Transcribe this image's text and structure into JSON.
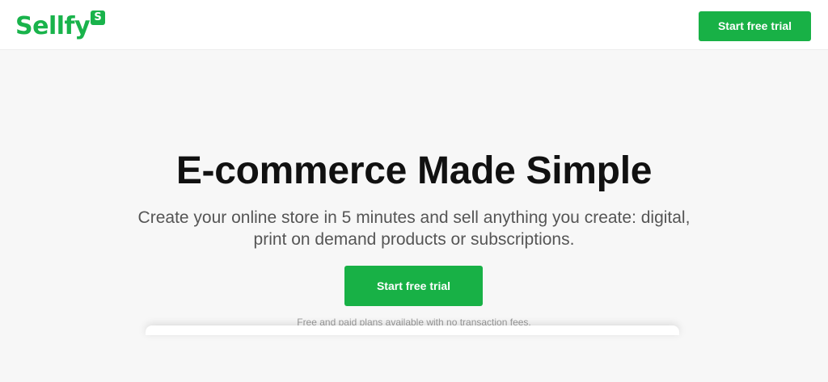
{
  "header": {
    "logo_text": "Sellfy",
    "logo_badge": "S",
    "cta_label": "Start free trial"
  },
  "hero": {
    "title": "E-commerce Made Simple",
    "subtitle": "Create your online store in 5 minutes and sell anything you create: digital, print on demand products or subscriptions.",
    "cta_label": "Start free trial",
    "note": "Free and paid plans available with no transaction fees."
  },
  "colors": {
    "brand_green": "#19b34b",
    "button_green": "#18b146",
    "title_text": "#111111",
    "subtitle_text": "#555555",
    "note_text": "#9a9a9a",
    "page_background": "#f7f7f7",
    "header_background": "#ffffff"
  }
}
